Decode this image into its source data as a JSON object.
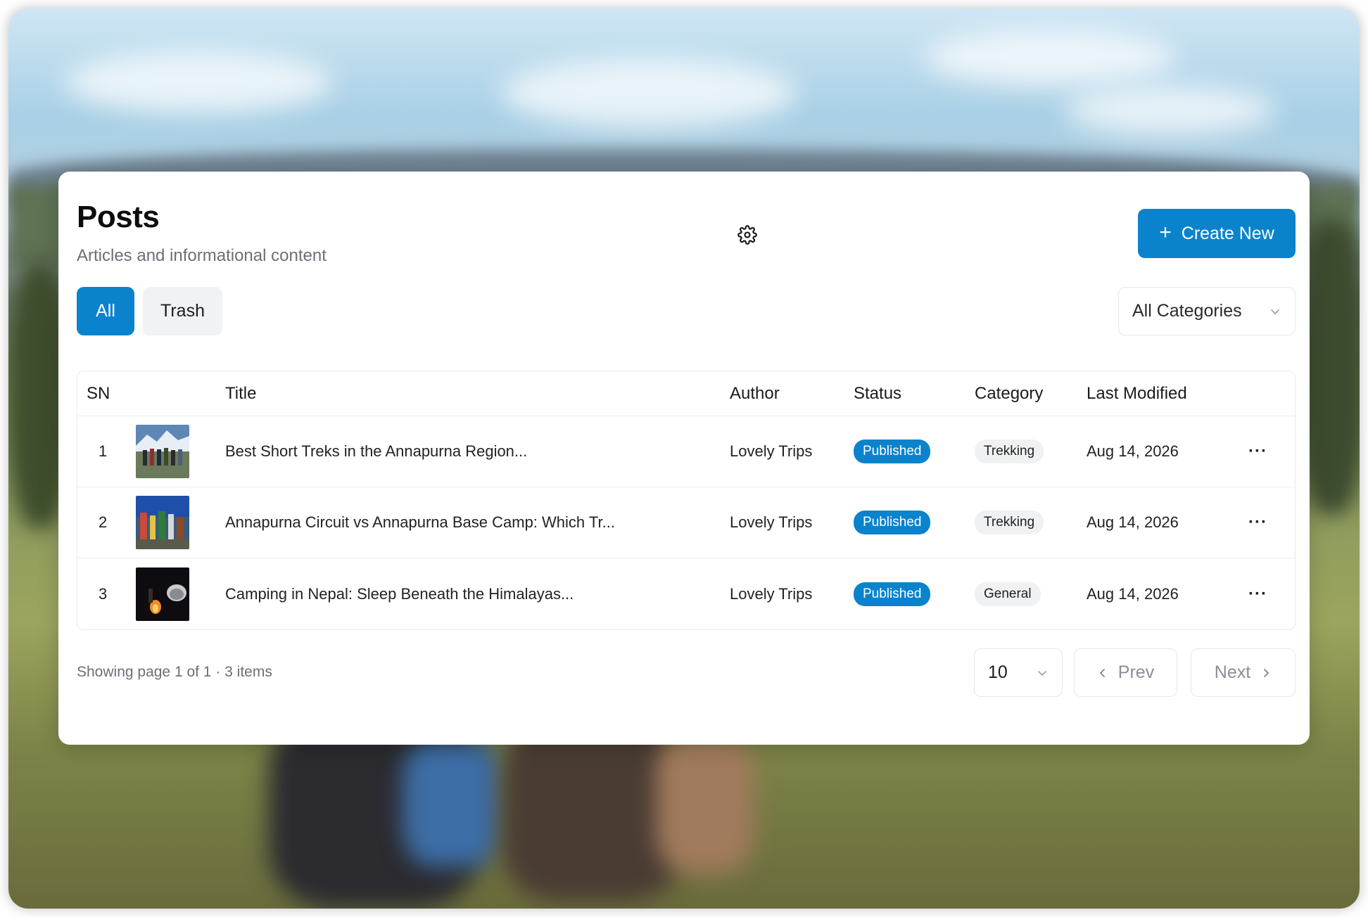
{
  "header": {
    "title": "Posts",
    "subtitle": "Articles and informational content",
    "create_label": "Create New"
  },
  "tabs": [
    {
      "label": "All",
      "active": true
    },
    {
      "label": "Trash",
      "active": false
    }
  ],
  "category_filter": {
    "selected": "All Categories"
  },
  "table": {
    "columns": [
      "SN",
      "Title",
      "Author",
      "Status",
      "Category",
      "Last Modified"
    ],
    "rows": [
      {
        "sn": "1",
        "title": "Best Short Treks in the Annapurna Region...",
        "author": "Lovely Trips",
        "status": "Published",
        "category": "Trekking",
        "modified": "Aug 14, 2026",
        "more": "···"
      },
      {
        "sn": "2",
        "title": "Annapurna Circuit vs Annapurna Base Camp: Which Tr...",
        "author": "Lovely Trips",
        "status": "Published",
        "category": "Trekking",
        "modified": "Aug 14, 2026",
        "more": "···"
      },
      {
        "sn": "3",
        "title": "Camping in Nepal: Sleep Beneath the Himalayas...",
        "author": "Lovely Trips",
        "status": "Published",
        "category": "General",
        "modified": "Aug 14, 2026",
        "more": "···"
      }
    ]
  },
  "pagination": {
    "info": "Showing page 1 of 1 · 3 items",
    "per_page": "10",
    "prev_label": "Prev",
    "next_label": "Next"
  },
  "colors": {
    "accent": "#0a83cc"
  }
}
